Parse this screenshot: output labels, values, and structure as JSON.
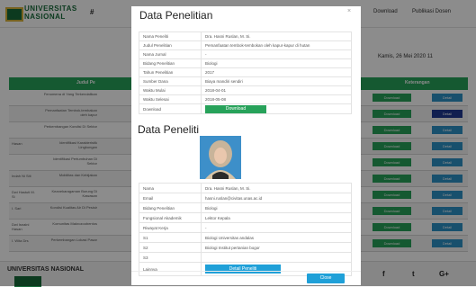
{
  "site": {
    "brand_line1": "UNIVERSITAS",
    "brand_line2": "NASIONAL",
    "nav_hash": "#",
    "nav_right_1": "Download",
    "nav_right_2": "Publikasi Dosen",
    "date": "Kamis, 26 Mei 2020 11",
    "table_head_judul": "Judul Pe",
    "table_head_keterangan": "Keterangan",
    "rows": [
      {
        "c1": "",
        "c2": "Fenomena di Yang Terkendalikan",
        "dark": false
      },
      {
        "c1": "",
        "c2": "Pemanfaatan Tembok-tembakan oleh kapur",
        "dark": true
      },
      {
        "c1": "",
        "c2": "Perkembangan Kondisi Di Sektor",
        "dark": false
      },
      {
        "c1": "Hasan",
        "c2": "Identifikasi Karakteristik Lingkungan",
        "dark": false
      },
      {
        "c1": "",
        "c2": "Identifikasi Pertumbuhan Di Sektor",
        "dark": false
      },
      {
        "c1": "Indah Ni Siti",
        "c2": "Mobilitas dan Kebijakan",
        "dark": false
      },
      {
        "c1": "Dwi Hastuti M. Si",
        "c2": "Keanekaragaman Burung Di Kawasan",
        "dark": false
      },
      {
        "c1": "I. Sari",
        "c2": "Kondisi Kualitas Air Di Pesisir",
        "dark": false
      },
      {
        "c1": "Dwi Isnaini Hasan",
        "c2": "Komunitas Makrozoobentos",
        "dark": false
      },
      {
        "c1": "I. Wita Drs",
        "c2": "Perkembangan Lokasi Pasar",
        "dark": false
      }
    ],
    "download_label": "Download",
    "detail_label": "Detail",
    "footer_title": "UNIVERSITAS NASIONAL",
    "social": [
      "f",
      "t",
      "G+"
    ]
  },
  "modal": {
    "title": "Data Penelitian",
    "close_x": "×",
    "penelitian": [
      {
        "k": "Nama Peneliti",
        "v": "Dra. Hasni Ruslan, M. Si."
      },
      {
        "k": "Judul Penelitian",
        "v": "Pemanfaatan tembok-tembokan oleh kapur-kapur di hutan"
      },
      {
        "k": "Nama Jurnal",
        "v": "-"
      },
      {
        "k": "Bidang Penelitian",
        "v": "Biologi"
      },
      {
        "k": "Tahun Penelitian",
        "v": "2017"
      },
      {
        "k": "Sumber Dana",
        "v": "Biaya mandiri sendiri"
      },
      {
        "k": "Waktu Mulai",
        "v": "2018-04-01"
      },
      {
        "k": "Waktu Selesai",
        "v": "2018-05-08"
      }
    ],
    "download_key": "Download",
    "download_button": "Download",
    "peneliti_title": "Data Peneliti",
    "peneliti": [
      {
        "k": "Nama",
        "v": "Dra. Hasni Ruslan, M. Si."
      },
      {
        "k": "Email",
        "v": "hasni.ruslan@civitas.unas.ac.id"
      },
      {
        "k": "Bidang Penelitian",
        "v": "Biologi"
      },
      {
        "k": "Fungsional Akademik",
        "v": "Lektor Kepala"
      },
      {
        "k": "Riwayat Kerja",
        "v": "-"
      },
      {
        "k": "S1",
        "v": "Biologi Universitas andalas"
      },
      {
        "k": "S2",
        "v": "Biologi Institut pertanian bogor"
      },
      {
        "k": "S3",
        "v": ""
      }
    ],
    "lainnya_key": "Lainnya",
    "detail_button": "Detail Peneliti",
    "close_button": "Close"
  },
  "colors": {
    "green": "#27a25a",
    "blue": "#1fa0d8",
    "brand_green": "#176b3a"
  }
}
